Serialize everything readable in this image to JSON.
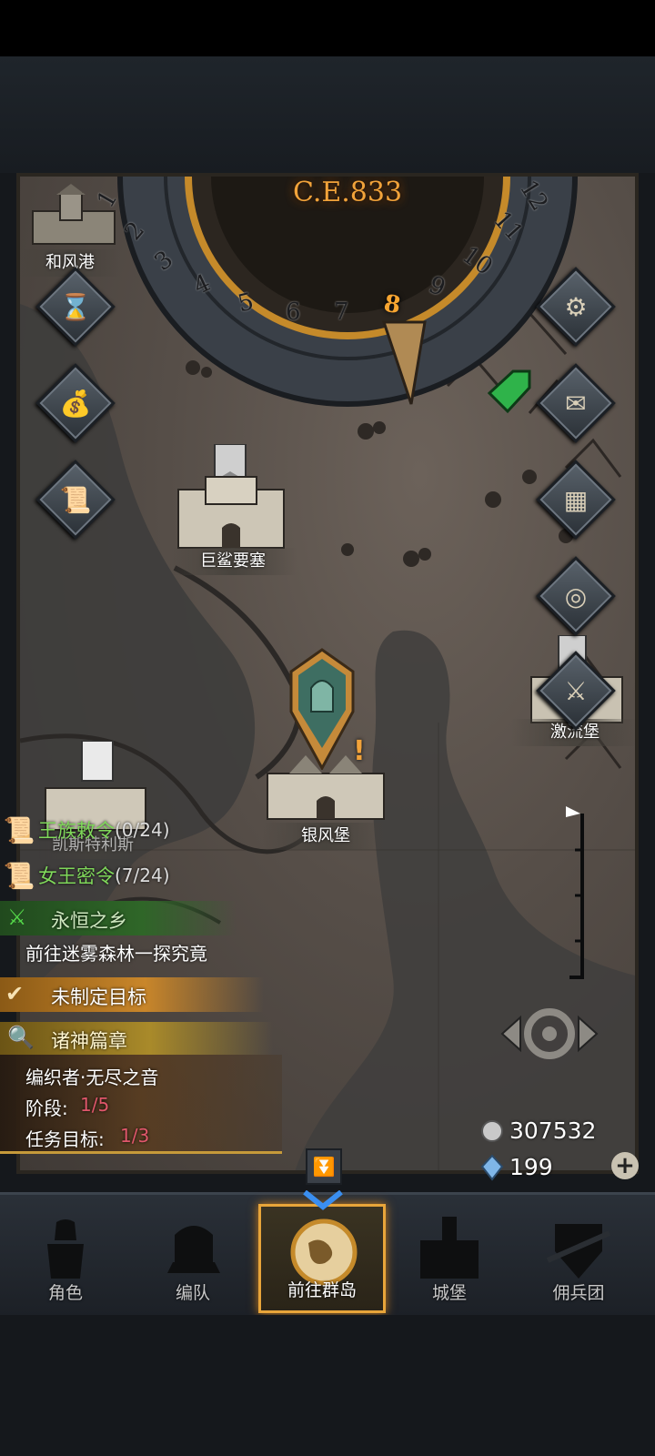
{
  "calendar": {
    "year_label": "C.E.833",
    "months": [
      "1",
      "2",
      "3",
      "4",
      "5",
      "6",
      "7",
      "8",
      "9",
      "10",
      "11",
      "12"
    ],
    "current_month": "8"
  },
  "towns": [
    {
      "name": "和风港"
    },
    {
      "name": "巨鲨要塞"
    },
    {
      "name": "激流堡"
    },
    {
      "name": "银风堡"
    },
    {
      "name": "凯斯特利斯"
    }
  ],
  "decrees": [
    {
      "label": "王族敕令",
      "count": "(0/24)"
    },
    {
      "label": "女王密令",
      "count": "(7/24)"
    }
  ],
  "main_quest": {
    "title": "永恒之乡",
    "description": "前往迷雾森林一探究竟"
  },
  "goal_bar": {
    "label": "未制定目标"
  },
  "chapter": {
    "title": "诸神篇章",
    "subtitle": "编织者·无尽之音",
    "stage_label": "阶段:",
    "stage_value": "1/5",
    "objective_label": "任务目标:",
    "objective_value": "1/3"
  },
  "resources": {
    "silver": "307532",
    "crystal": "199"
  },
  "nav": {
    "items": [
      {
        "label": "角色",
        "icon": "knight-icon"
      },
      {
        "label": "编队",
        "icon": "helmet-icon"
      },
      {
        "label": "前往群岛",
        "icon": "world-map-icon"
      },
      {
        "label": "城堡",
        "icon": "castle-icon"
      },
      {
        "label": "佣兵团",
        "icon": "mercenary-icon"
      }
    ],
    "active_index": 2
  },
  "colors": {
    "accent_orange": "#f2a33a",
    "quest_green": "#7fd85a",
    "progress_red": "#e0576b"
  }
}
